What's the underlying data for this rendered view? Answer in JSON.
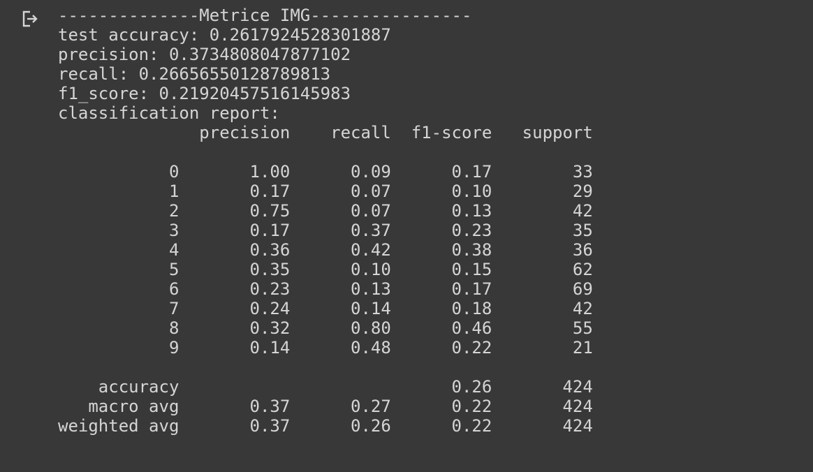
{
  "icon": "output-clear-icon",
  "lines": [
    "--------------Metrice IMG----------------",
    "test accuracy: 0.2617924528301887",
    "precision: 0.3734808047877102",
    "recall: 0.26656550128789813",
    "f1_score: 0.21920457516145983",
    "classification report:",
    "              precision    recall  f1-score   support",
    "",
    "           0       1.00      0.09      0.17        33",
    "           1       0.17      0.07      0.10        29",
    "           2       0.75      0.07      0.13        42",
    "           3       0.17      0.37      0.23        35",
    "           4       0.36      0.42      0.38        36",
    "           5       0.35      0.10      0.15        62",
    "           6       0.23      0.13      0.17        69",
    "           7       0.24      0.14      0.18        42",
    "           8       0.32      0.80      0.46        55",
    "           9       0.14      0.48      0.22        21",
    "",
    "    accuracy                           0.26       424",
    "   macro avg       0.37      0.27      0.22       424",
    "weighted avg       0.37      0.26      0.22       424"
  ]
}
